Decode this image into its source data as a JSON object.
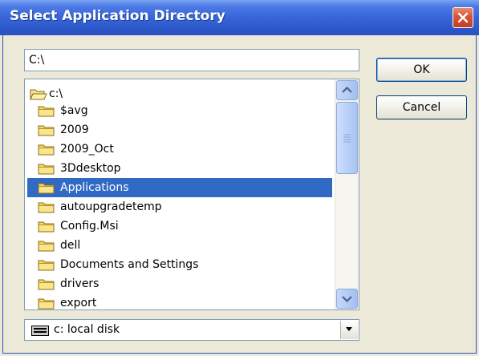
{
  "window": {
    "title": "Select Application Directory"
  },
  "path_field": {
    "value": "C:\\"
  },
  "buttons": {
    "ok_label": "OK",
    "cancel_label": "Cancel"
  },
  "tree": {
    "root_label": "c:\\",
    "root_icon": "open-folder-icon",
    "folder_icon": "folder-icon",
    "items": [
      {
        "label": "$avg",
        "selected": false
      },
      {
        "label": "2009",
        "selected": false
      },
      {
        "label": "2009_Oct",
        "selected": false
      },
      {
        "label": "3Ddesktop",
        "selected": false
      },
      {
        "label": "Applications",
        "selected": true
      },
      {
        "label": "autoupgradetemp",
        "selected": false
      },
      {
        "label": "Config.Msi",
        "selected": false
      },
      {
        "label": "dell",
        "selected": false
      },
      {
        "label": "Documents and Settings",
        "selected": false
      },
      {
        "label": "drivers",
        "selected": false
      },
      {
        "label": "export",
        "selected": false
      }
    ],
    "scroll_position": 0.0
  },
  "drive_select": {
    "value": "c:  local disk",
    "icon": "hard-drive-icon"
  },
  "colors": {
    "titlebar": "#2b56c8",
    "selection": "#316ac5",
    "close_button": "#d4543a",
    "dialog_bg": "#ece9d8"
  }
}
